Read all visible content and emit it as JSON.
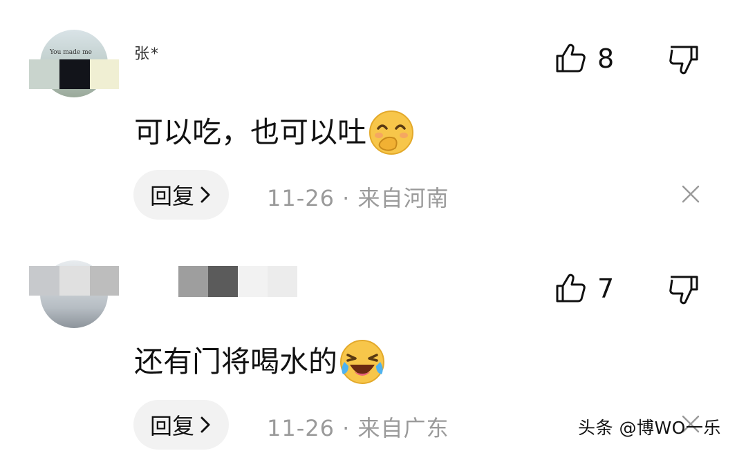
{
  "comments": [
    {
      "username": "张*",
      "like_count": "8",
      "text": "可以吃，也可以吐",
      "emoji": "smile-covering-mouth-emoji",
      "reply_label": "回复",
      "meta": "11-26 · 来自河南",
      "avatar_text": "You made me"
    },
    {
      "username": "",
      "like_count": "7",
      "text": "还有门将喝水的",
      "emoji": "laughing-crying-emoji",
      "reply_label": "回复",
      "meta": "11-26 · 来自广东"
    }
  ],
  "watermark": "头条 @博WO一乐",
  "icons": {
    "like": "thumbs-up-icon",
    "dislike": "thumbs-down-icon",
    "reply_chevron": "chevron-right-icon",
    "close": "close-icon"
  },
  "colors": {
    "meta_gray": "#9a9a9a",
    "reply_bg": "#f2f2f2",
    "emoji_yellow": "#f7c64a"
  }
}
